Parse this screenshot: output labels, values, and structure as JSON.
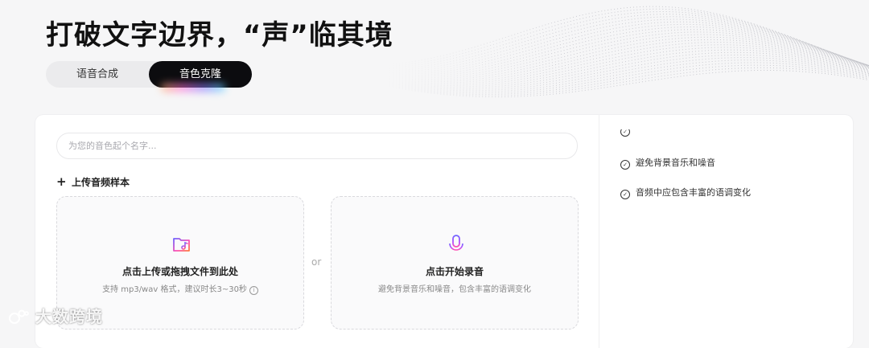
{
  "hero": {
    "title": "打破文字边界，“声”临其境"
  },
  "tabs": [
    {
      "label": "语音合成",
      "active": false
    },
    {
      "label": "音色克隆",
      "active": true
    }
  ],
  "clone_form": {
    "name_placeholder": "为您的音色起个名字...",
    "upload_section_label": "上传音频样本",
    "upload_box": {
      "title": "点击上传或拖拽文件到此处",
      "hint": "支持 mp3/wav 格式，建议时长3~30秒",
      "icon": "folder-music-icon"
    },
    "divider_text": "or",
    "record_box": {
      "title": "点击开始录音",
      "hint": "避免背景音乐和噪音，包含丰富的语调变化",
      "icon": "microphone-icon"
    }
  },
  "tips": [
    "避免背景音乐和噪音",
    "音频中应包含丰富的语调变化"
  ],
  "watermark": "大数跨境",
  "colors": {
    "active_tab_bg": "#0c0c0f",
    "icon_gradient": [
      "#ff7a3d",
      "#ff4fb3",
      "#6f63ff"
    ]
  }
}
